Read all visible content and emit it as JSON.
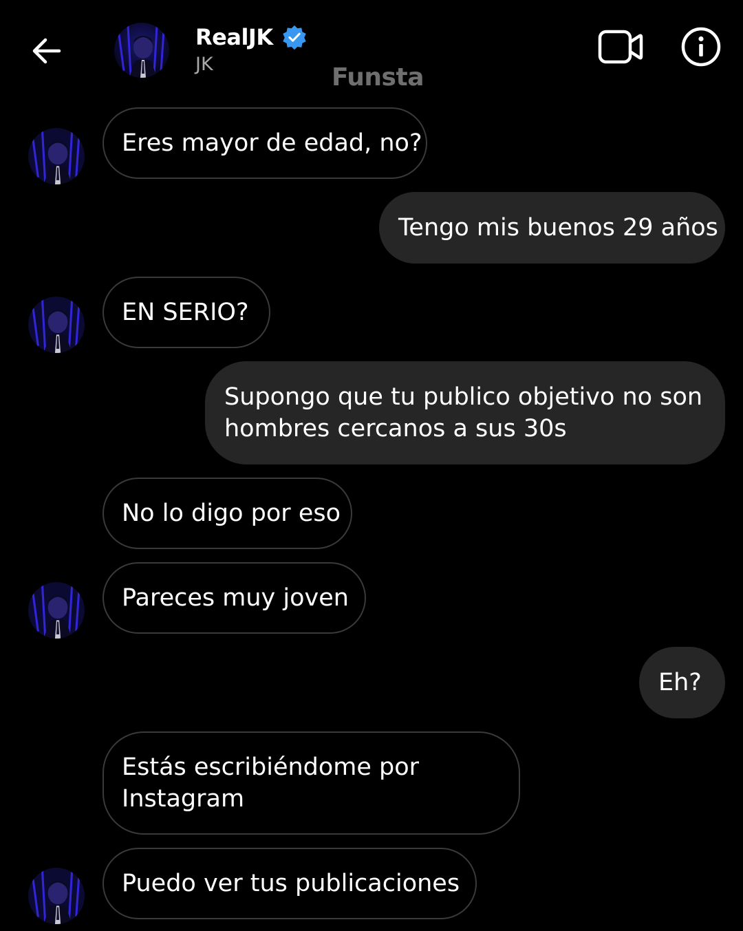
{
  "header": {
    "back_icon": "arrow-left-icon",
    "contact_name": "RealJK",
    "verified_icon": "verified-badge-icon",
    "contact_username": "JK",
    "watermark": "Funsta",
    "video_icon": "video-camera-icon",
    "info_icon": "info-circle-icon"
  },
  "colors": {
    "background": "#000000",
    "incoming_border": "#3a3a3a",
    "outgoing_bg": "#262626",
    "verified": "#3897f0",
    "secondary_text": "#a8a8a8"
  },
  "messages": [
    {
      "side": "in",
      "text": "Eres mayor de edad, no?",
      "avatar": true
    },
    {
      "side": "out",
      "text": "Tengo mis buenos 29 años"
    },
    {
      "side": "in",
      "text": "EN SERIO?",
      "avatar": true
    },
    {
      "side": "out",
      "text": "Supongo que tu publico objetivo no son hombres cercanos a sus 30s"
    },
    {
      "side": "in",
      "text": "No lo digo por eso",
      "avatar": false
    },
    {
      "side": "in",
      "text": "Pareces muy joven",
      "avatar": true
    },
    {
      "side": "out",
      "text": "Eh?"
    },
    {
      "side": "in",
      "text": "Estás escribiéndome por Instagram",
      "avatar": false
    },
    {
      "side": "in",
      "text": "Puedo ver tus publicaciones",
      "avatar": true
    }
  ]
}
